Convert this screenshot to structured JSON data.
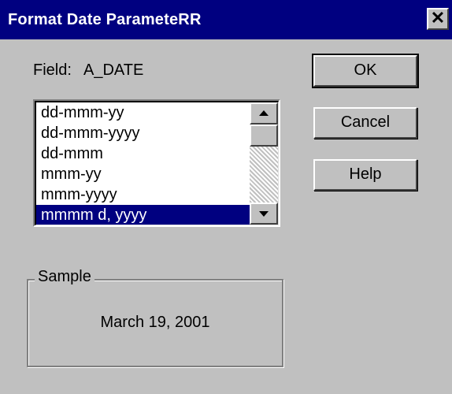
{
  "window": {
    "title": "Format Date ParameteRR",
    "close_glyph": "✕"
  },
  "field": {
    "label": "Field:",
    "value": "A_DATE"
  },
  "buttons": {
    "ok": "OK",
    "cancel": "Cancel",
    "help": "Help"
  },
  "format_list": {
    "items": [
      "dd-mmm-yy",
      "dd-mmm-yyyy",
      "dd-mmm",
      "mmm-yy",
      "mmm-yyyy",
      "mmmm d, yyyy"
    ],
    "selected_index": 5,
    "scroll_up_icon": "arrow-up",
    "scroll_down_icon": "arrow-down"
  },
  "sample": {
    "label": "Sample",
    "value": "March 19, 2001"
  },
  "colors": {
    "titlebar": "#000080",
    "face": "#c0c0c0",
    "selection": "#000080"
  }
}
